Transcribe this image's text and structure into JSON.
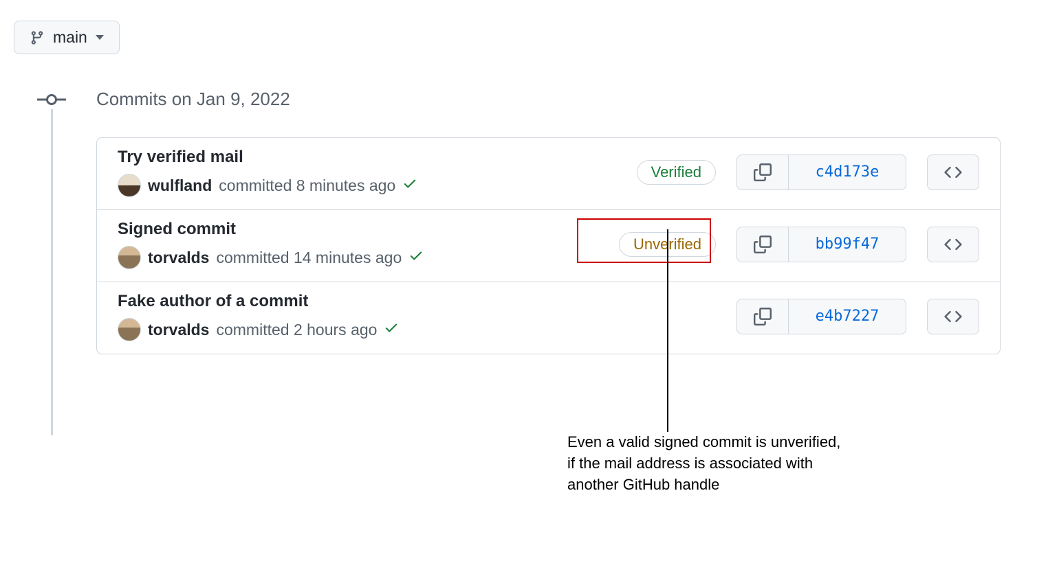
{
  "branch": {
    "name": "main"
  },
  "dateHeading": "Commits on Jan 9, 2022",
  "commits": [
    {
      "title": "Try verified mail",
      "author": "wulfland",
      "avatar": "beard",
      "meta": "committed 8 minutes ago",
      "verification": "Verified",
      "sha": "c4d173e"
    },
    {
      "title": "Signed commit",
      "author": "torvalds",
      "avatar": "man",
      "meta": "committed 14 minutes ago",
      "verification": "Unverified",
      "sha": "bb99f47",
      "highlighted": true
    },
    {
      "title": "Fake author of a commit",
      "author": "torvalds",
      "avatar": "man",
      "meta": "committed 2 hours ago",
      "verification": null,
      "sha": "e4b7227"
    }
  ],
  "annotation": {
    "line1": "Even a valid signed commit is unverified,",
    "line2": "if the mail address is associated with",
    "line3": "another GitHub handle"
  }
}
